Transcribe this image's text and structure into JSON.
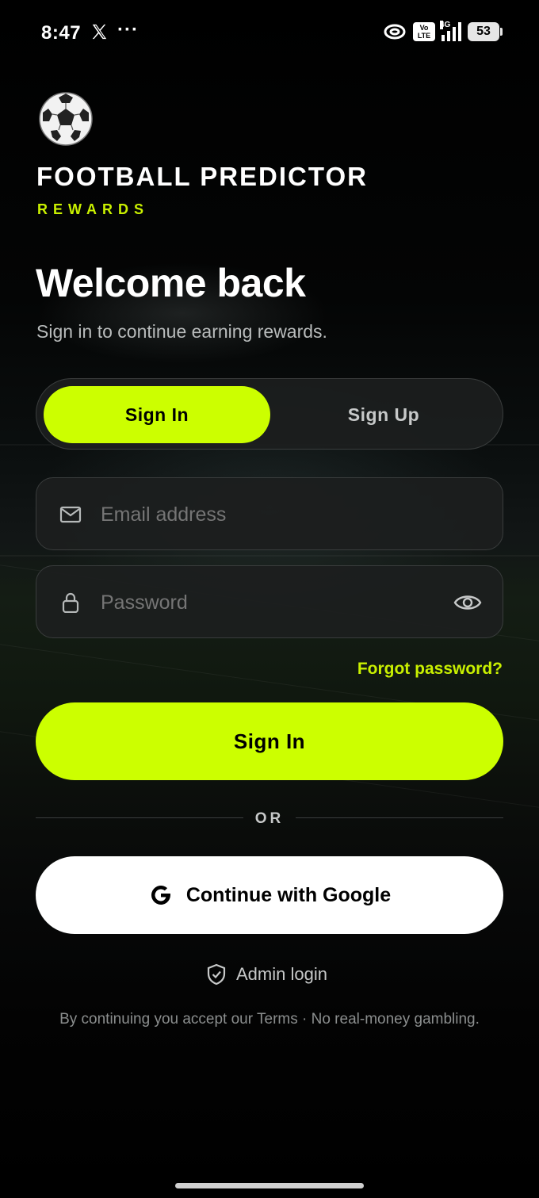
{
  "status_bar": {
    "time": "8:47",
    "more": "···",
    "volte": "Vo LTE",
    "network": "4G",
    "battery": "53"
  },
  "brand": {
    "title": "FOOTBALL PREDICTOR",
    "subtitle": "REWARDS",
    "logo_icon": "soccer-ball-icon"
  },
  "header": {
    "title": "Welcome back",
    "subtitle": "Sign in to continue earning rewards."
  },
  "tabs": [
    {
      "label": "Sign In",
      "active": true
    },
    {
      "label": "Sign Up",
      "active": false
    }
  ],
  "form": {
    "email_placeholder": "Email address",
    "password_placeholder": "Password",
    "forgot_label": "Forgot password?",
    "submit_label": "Sign In"
  },
  "divider": {
    "label": "OR"
  },
  "google": {
    "label": "Continue with Google"
  },
  "admin": {
    "label": "Admin login"
  },
  "footer": {
    "terms": "By continuing you accept our Terms · No real-money gambling."
  },
  "colors": {
    "accent": "#ccff00",
    "background": "#000000",
    "field": "#1c1e1e"
  }
}
